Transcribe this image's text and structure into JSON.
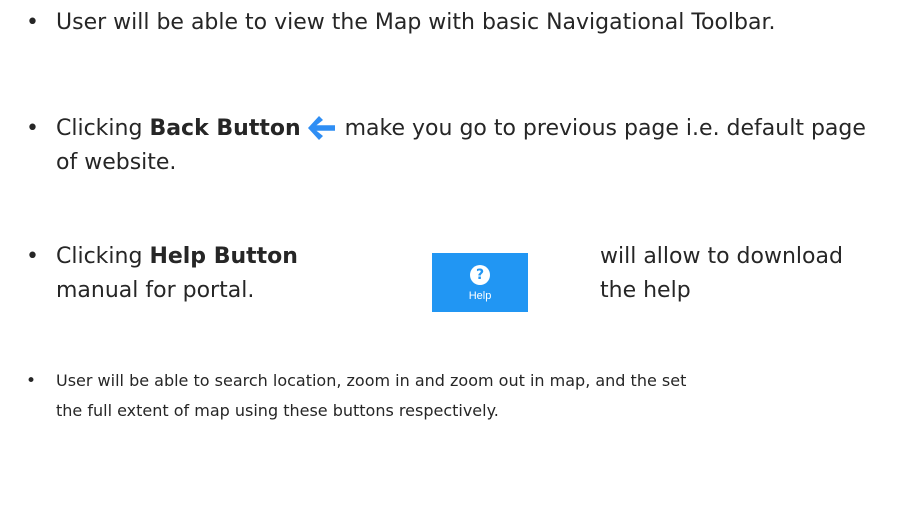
{
  "bullets": [
    {
      "symbol": "•",
      "text": "User will be able to view the Map with basic Navigational Toolbar."
    },
    {
      "symbol": "•",
      "prefix": "Clicking ",
      "bold": "Back Button",
      "suffix": "make you go to previous page i.e. default page of website."
    },
    {
      "symbol": "•",
      "prefix": "Clicking ",
      "bold": "Help Button",
      "suffix_line1": "will allow to download the help",
      "suffix_line2": "manual for portal."
    },
    {
      "symbol": "•",
      "text": "User will be able to search location, zoom in and zoom out in map, and the set the full extent of map using these buttons respectively."
    }
  ],
  "back_icon": {
    "name": "back-arrow-icon",
    "color": "#2f8ef4"
  },
  "help_button": {
    "icon": "question-circle-icon",
    "icon_glyph": "?",
    "label": "Help",
    "color": "#2196f3"
  }
}
